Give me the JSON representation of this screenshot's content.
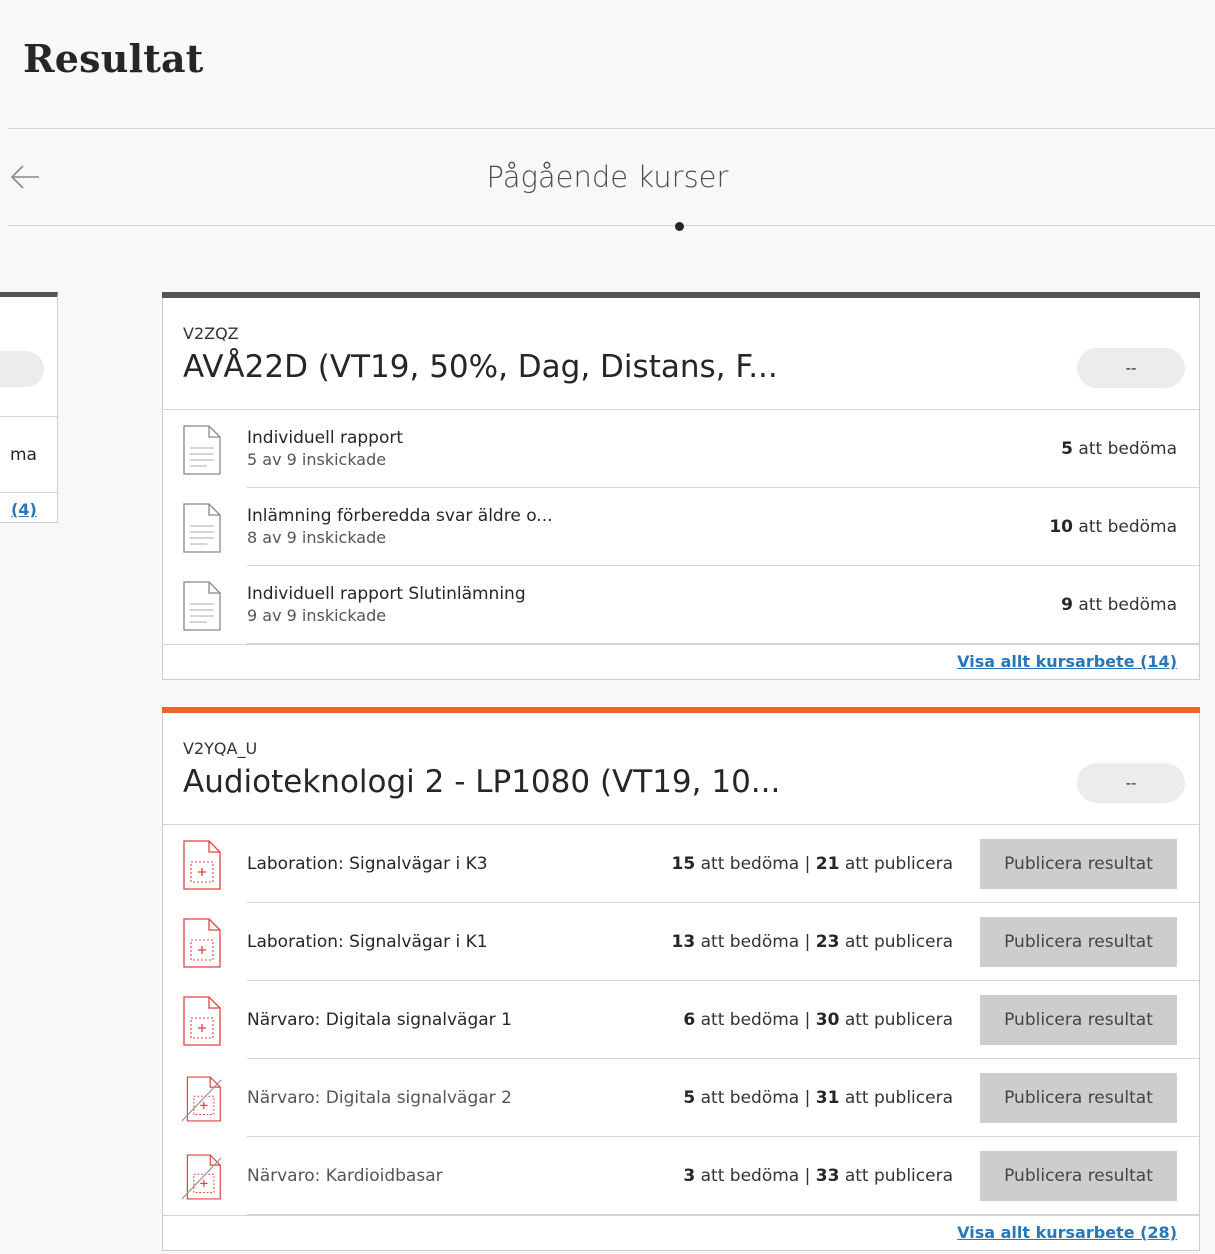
{
  "page": {
    "title": "Resultat"
  },
  "carousel": {
    "title": "Pågående kurser"
  },
  "partial_card": {
    "count_text_fragment": "ma",
    "link_fragment": "(4)"
  },
  "courses": [
    {
      "code": "V2ZQZ",
      "name": "AVÅ22D (VT19, 50%, Dag, Distans, F...",
      "grade": "--",
      "accent": "#555555",
      "items": [
        {
          "title": "Individuell rapport",
          "submitted": "5 av 9 inskickade",
          "count": "5",
          "count_label": "att bedöma"
        },
        {
          "title": "Inlämning förberedda svar äldre o...",
          "submitted": "8 av 9 inskickade",
          "count": "10",
          "count_label": "att bedöma"
        },
        {
          "title": "Individuell rapport Slutinlämning",
          "submitted": "9 av 9 inskickade",
          "count": "9",
          "count_label": "att bedöma"
        }
      ],
      "view_all": "Visa allt kursarbete (14)"
    },
    {
      "code": "V2YQA_U",
      "name": "Audioteknologi 2 - LP1080 (VT19, 10...",
      "grade": "--",
      "accent": "#ee6622",
      "items": [
        {
          "title": "Laboration: Signalvägar i K3",
          "grade_count": "15",
          "grade_label": "att bedöma",
          "sep": "|",
          "publish_count": "21",
          "publish_label": "att publicera",
          "button": "Publicera resultat"
        },
        {
          "title": "Laboration: Signalvägar i K1",
          "grade_count": "13",
          "grade_label": "att bedöma",
          "sep": "|",
          "publish_count": "23",
          "publish_label": "att publicera",
          "button": "Publicera resultat"
        },
        {
          "title": "Närvaro: Digitala signalvägar 1",
          "grade_count": "6",
          "grade_label": "att bedöma",
          "sep": "|",
          "publish_count": "30",
          "publish_label": "att publicera",
          "button": "Publicera resultat"
        },
        {
          "title": "Närvaro: Digitala signalvägar 2",
          "grade_count": "5",
          "grade_label": "att bedöma",
          "sep": "|",
          "publish_count": "31",
          "publish_label": "att publicera",
          "button": "Publicera resultat"
        },
        {
          "title": "Närvaro: Kardioidbasar",
          "grade_count": "3",
          "grade_label": "att bedöma",
          "sep": "|",
          "publish_count": "33",
          "publish_label": "att publicera",
          "button": "Publicera resultat"
        }
      ],
      "view_all": "Visa allt kursarbete (28)"
    }
  ],
  "icons": {
    "document": "document-icon",
    "assignment": "assignment-icon",
    "hidden_assignment": "hidden-assignment-icon",
    "back": "back-arrow-icon"
  }
}
